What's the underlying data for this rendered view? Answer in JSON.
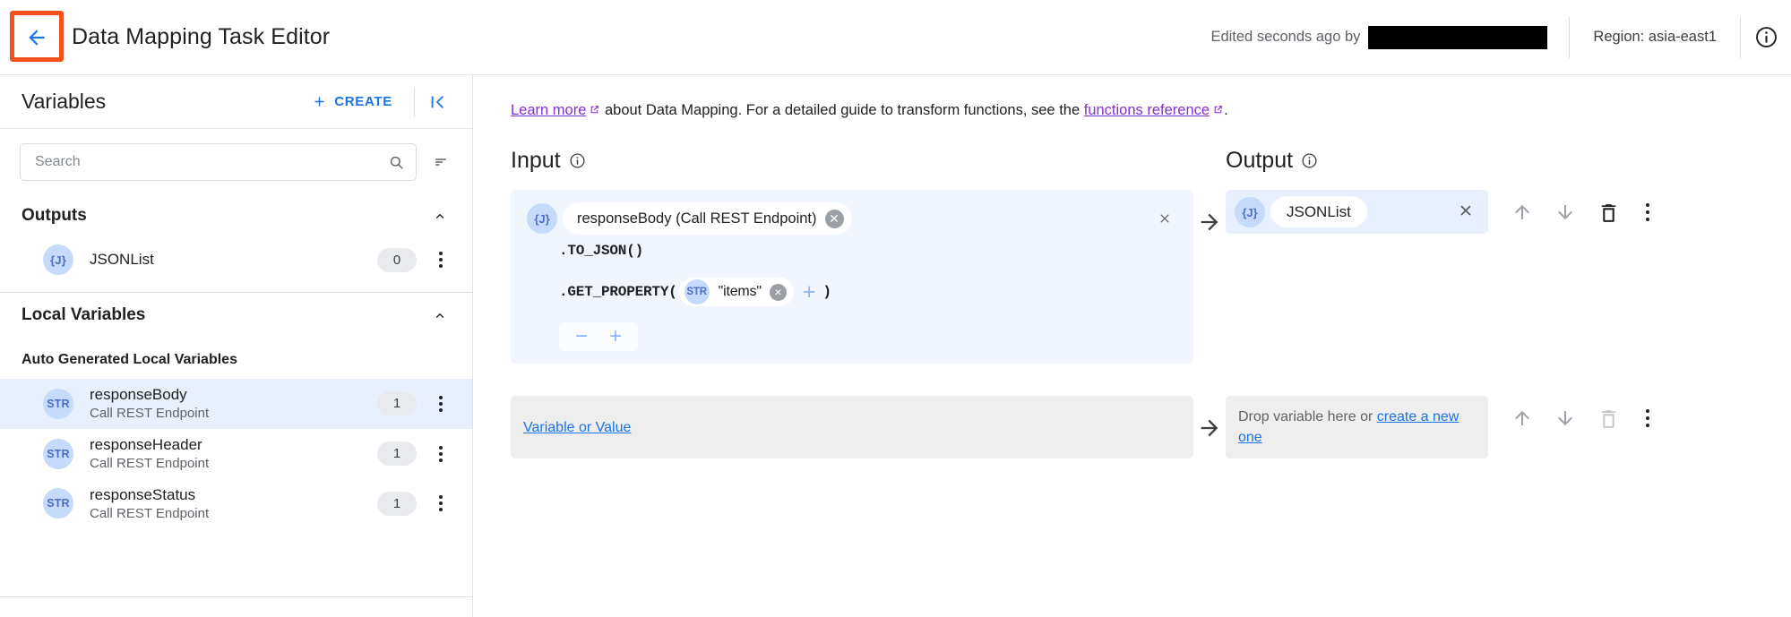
{
  "header": {
    "title": "Data Mapping Task Editor",
    "back_icon": "arrow-left-icon",
    "edited_text": "Edited seconds ago by",
    "region_text": "Region: asia-east1",
    "info_icon": "info-icon",
    "highlight_color": "#f4511e"
  },
  "sidebar": {
    "title": "Variables",
    "create_label": "CREATE",
    "create_icon": "plus-icon",
    "collapse_icon": "collapse-panel-icon",
    "search": {
      "placeholder": "Search",
      "value": "",
      "search_icon": "search-icon",
      "filter_icon": "sort-filter-icon"
    },
    "sections": [
      {
        "title": "Outputs",
        "chevron": "chevron-up-icon",
        "items": [
          {
            "badge": "{J}",
            "badge_type": "json",
            "name": "JSONList",
            "sub": "",
            "count": "0",
            "selected": false
          }
        ]
      },
      {
        "title": "Local Variables",
        "chevron": "chevron-up-icon",
        "sub_header": "Auto Generated Local Variables",
        "items": [
          {
            "badge": "STR",
            "badge_type": "string",
            "name": "responseBody",
            "sub": "Call REST Endpoint",
            "count": "1",
            "selected": true
          },
          {
            "badge": "STR",
            "badge_type": "string",
            "name": "responseHeader",
            "sub": "Call REST Endpoint",
            "count": "1",
            "selected": false
          },
          {
            "badge": "STR",
            "badge_type": "string",
            "name": "responseStatus",
            "sub": "Call REST Endpoint",
            "count": "1",
            "selected": false
          }
        ]
      }
    ]
  },
  "main": {
    "notice": {
      "link1": "Learn more",
      "mid": " about Data Mapping. For a detailed guide to transform functions, see the ",
      "link2": "functions reference",
      "end": ".",
      "external_icon": "external-link-icon",
      "link_color": "#8430ce"
    },
    "input_title": "Input",
    "output_title": "Output",
    "info_icon": "info-icon",
    "arrow_icon": "arrow-right-icon",
    "rows": [
      {
        "input": {
          "badge": "{J}",
          "chip_label": "responseBody (Call REST Endpoint)",
          "chip_remove_icon": "remove-chip-icon",
          "close_icon": "close-icon",
          "functions": [
            {
              "name": ".TO_JSON(",
              "close": ")",
              "args": []
            },
            {
              "name": ".GET_PROPERTY(",
              "close": ")",
              "args": [
                {
                  "badge": "STR",
                  "value": "\"items\"",
                  "remove_icon": "remove-arg-icon"
                }
              ],
              "add_icon": "add-arg-icon"
            }
          ],
          "stepper": {
            "minus": "−",
            "plus": "+"
          }
        },
        "output": {
          "badge": "{J}",
          "label": "JSONList",
          "clear_icon": "close-icon",
          "placeholder": "",
          "actions": {
            "move_up": "arrow-up-icon",
            "move_down": "arrow-down-icon",
            "delete": "trash-icon",
            "more": "more-vertical-icon",
            "delete_disabled": false
          }
        }
      },
      {
        "input": {
          "link_label": "Variable or Value"
        },
        "output": {
          "drop_prefix": "Drop variable here or ",
          "drop_link": "create a new one",
          "actions": {
            "move_up": "arrow-up-icon",
            "move_down": "arrow-down-icon",
            "delete": "trash-icon",
            "more": "more-vertical-icon",
            "delete_disabled": true
          }
        }
      }
    ]
  }
}
